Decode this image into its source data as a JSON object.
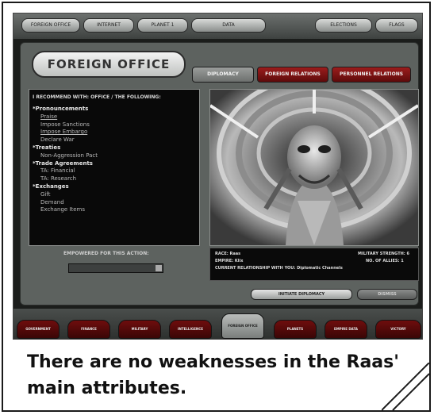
{
  "caption": "There are no weaknesses in the Raas' main attributes.",
  "screen": {
    "top_tabs": [
      "FOREIGN OFFICE",
      "INTERNET",
      "PLANET 1",
      "DATA",
      "ELECTIONS",
      "FLAGS"
    ],
    "title": "FOREIGN OFFICE",
    "tabs": [
      {
        "label": "DIPLOMACY",
        "active": true
      },
      {
        "label": "FOREIGN RELATIONS",
        "active": false
      },
      {
        "label": "PERSONNEL RELATIONS",
        "active": false
      }
    ],
    "left_header": "I RECOMMEND WITH: OFFICE / THE FOLLOWING:",
    "menu": [
      {
        "text": "*Pronouncements",
        "kind": "head"
      },
      {
        "text": "Praise",
        "kind": "sub link"
      },
      {
        "text": "Impose Sanctions",
        "kind": "sub"
      },
      {
        "text": "Impose Embargo",
        "kind": "sub link"
      },
      {
        "text": "Declare War",
        "kind": "sub"
      },
      {
        "text": "*Treaties",
        "kind": "head"
      },
      {
        "text": "Non-Aggression Pact",
        "kind": "sub"
      },
      {
        "text": "*Trade Agreements",
        "kind": "head"
      },
      {
        "text": "TA: Financial",
        "kind": "sub"
      },
      {
        "text": "TA: Research",
        "kind": "sub"
      },
      {
        "text": "*Exchanges",
        "kind": "head"
      },
      {
        "text": "Gift",
        "kind": "sub"
      },
      {
        "text": "Demand",
        "kind": "sub"
      },
      {
        "text": "Exchange Items",
        "kind": "sub"
      }
    ],
    "action_label": "EMPOWERED FOR THIS ACTION:",
    "dropdown_value": "",
    "info": {
      "race": "RACE: Raas",
      "empire": "EMPIRE: Klix",
      "relationship": "CURRENT RELATIONSHIP WITH YOU: Diplomatic Channels",
      "military": "MILITARY STRENGTH: 6",
      "allies": "NO. OF ALLIES: 1"
    },
    "footer_buttons": [
      "INITIATE DIPLOMACY",
      "DISMISS"
    ],
    "nav": [
      "GOVERNMENT",
      "FINANCE",
      "MILITARY",
      "INTELLIGENCE",
      "FOREIGN OFFICE",
      "PLANETS",
      "EMPIRE DATA",
      "VICTORY"
    ],
    "nav_active_index": 4,
    "colors": {
      "panel": "#5d625f",
      "accent_red": "#7a1010",
      "screen_bg": "#1b1d1b"
    }
  }
}
